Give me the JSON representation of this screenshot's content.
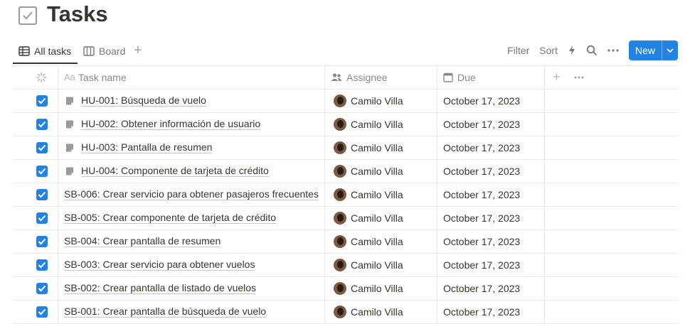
{
  "page": {
    "title": "Tasks",
    "icon": "checkbox-icon"
  },
  "views": {
    "tabs": [
      {
        "label": "All tasks",
        "icon": "table-icon",
        "active": true
      },
      {
        "label": "Board",
        "icon": "board-icon",
        "active": false
      }
    ]
  },
  "toolbar": {
    "filter_label": "Filter",
    "sort_label": "Sort",
    "new_label": "New"
  },
  "table": {
    "columns": {
      "task_name": "Task name",
      "assignee": "Assignee",
      "due": "Due"
    },
    "rows": [
      {
        "done": true,
        "has_page_icon": true,
        "name": "HU-001: Búsqueda de vuelo",
        "assignee": "Camilo Villa",
        "due": "October 17, 2023"
      },
      {
        "done": true,
        "has_page_icon": true,
        "name": "HU-002: Obtener información de usuario",
        "assignee": "Camilo Villa",
        "due": "October 17, 2023"
      },
      {
        "done": true,
        "has_page_icon": true,
        "name": "HU-003: Pantalla de resumen",
        "assignee": "Camilo Villa",
        "due": "October 17, 2023"
      },
      {
        "done": true,
        "has_page_icon": true,
        "name": "HU-004: Componente de tarjeta de crédito",
        "assignee": "Camilo Villa",
        "due": "October 17, 2023"
      },
      {
        "done": true,
        "has_page_icon": false,
        "name": "SB-006: Crear servicio para obtener pasajeros frecuentes",
        "assignee": "Camilo Villa",
        "due": "October 17, 2023"
      },
      {
        "done": true,
        "has_page_icon": false,
        "name": "SB-005: Crear componente de tarjeta de crédito",
        "assignee": "Camilo Villa",
        "due": "October 17, 2023"
      },
      {
        "done": true,
        "has_page_icon": false,
        "name": "SB-004: Crear pantalla de resumen",
        "assignee": "Camilo Villa",
        "due": "October 17, 2023"
      },
      {
        "done": true,
        "has_page_icon": false,
        "name": "SB-003: Crear servicio para obtener vuelos",
        "assignee": "Camilo Villa",
        "due": "October 17, 2023"
      },
      {
        "done": true,
        "has_page_icon": false,
        "name": "SB-002: Crear pantalla de listado de vuelos",
        "assignee": "Camilo Villa",
        "due": "October 17, 2023"
      },
      {
        "done": true,
        "has_page_icon": false,
        "name": "SB-001: Crear pantalla de búsqueda de vuelo",
        "assignee": "Camilo Villa",
        "due": "October 17, 2023"
      }
    ]
  },
  "colors": {
    "accent": "#2383e2",
    "text": "#37352f",
    "muted": "#787774",
    "border": "#e9e9e7"
  }
}
